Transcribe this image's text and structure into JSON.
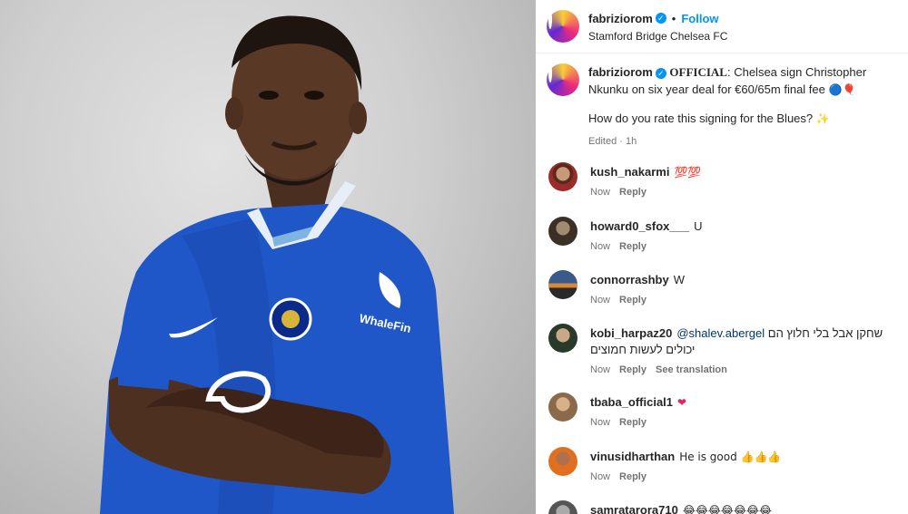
{
  "post": {
    "username": "fabriziorom",
    "verified_mark": "✓",
    "separator": "•",
    "follow_label": "Follow",
    "location": "Stamford Bridge Chelsea FC",
    "image": {
      "alt": "Player in blue Chelsea home kit with arms crossed",
      "kit_sponsor": "WhaleFin",
      "bg_color": "#c9c9c9",
      "kit_color": "#1f56c8"
    }
  },
  "caption": {
    "username": "fabriziorom",
    "bold_text": "OFFICIAL",
    "text": ": Chelsea sign Christopher Nkunku on six year deal for €60/65m final fee",
    "emojis": "🔵🎈",
    "second_line": "How do you rate this signing for the Blues?",
    "second_emoji": "✨",
    "edited": "Edited",
    "time": "1h"
  },
  "comments": [
    {
      "user": "kush_nakarmi",
      "mention": "",
      "text": "💯💯",
      "time": "Now",
      "reply": "Reply",
      "translate": ""
    },
    {
      "user": "howard0_sfox___",
      "mention": "",
      "text": "U",
      "time": "Now",
      "reply": "Reply",
      "translate": ""
    },
    {
      "user": "connorrashby",
      "mention": "",
      "text": "W",
      "time": "Now",
      "reply": "Reply",
      "translate": ""
    },
    {
      "user": "kobi_harpaz20",
      "mention": "@shalev.abergel",
      "text": "שחקן אבל בלי חלוץ הם יכולים לעשות חמוצים",
      "time": "Now",
      "reply": "Reply",
      "translate": "See translation"
    },
    {
      "user": "tbaba_official1",
      "mention": "",
      "text": "❤",
      "time": "Now",
      "reply": "Reply",
      "translate": ""
    },
    {
      "user": "vinusidharthan",
      "mention": "",
      "text": "He is good 👍👍👍",
      "time": "Now",
      "reply": "Reply",
      "translate": ""
    },
    {
      "user": "samratarora710",
      "mention": "",
      "text": "😂😂😂😂😂😂😂",
      "time": "",
      "reply": "",
      "translate": ""
    }
  ]
}
